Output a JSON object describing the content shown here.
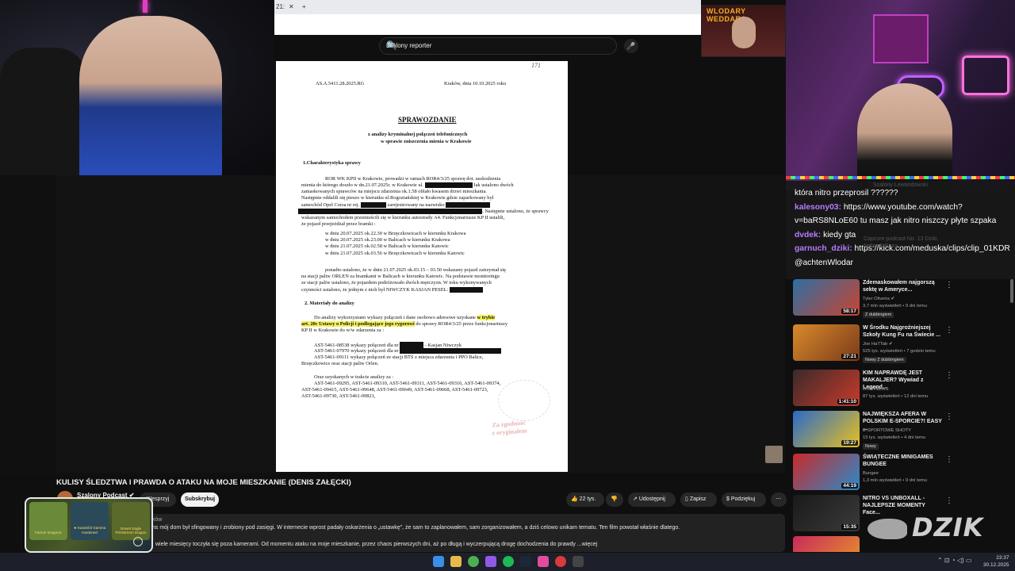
{
  "browser": {
    "tab_fragment": "21:",
    "close_tab": "✕",
    "new_tab": "+",
    "search_query": "szalony reporter",
    "keyboard_icon": "⌨",
    "clear": "✕",
    "search_icon": "🔍",
    "mic_icon": "🎤"
  },
  "overlay": {
    "logo_text": "WLODARY WEDDARA"
  },
  "document": {
    "page_mark": "171",
    "ref": "AS.A.5411.28.2025.RG",
    "place_date": "Kraków, dnia   10.10.2025 roku",
    "heading": "SPRAWOZDANIE",
    "sub1": "z analizy kryminalnej połączeń telefonicznych",
    "sub2": "w sprawie zniszczenia mienia w Krakowie",
    "sec1": "1.Charakterystyka sprawy",
    "p1_l1": "ROR WK KPII w Krakowie, prowadzi w ramach ROR4/3/25 sprawę dot. uszkodzenia",
    "p1_l2": "mienia do którego doszło w dn.21.07.2025r. w Krakowie ul.",
    "p1_l2b": "Jak ustalono dwóch",
    "p1_l3": "zamaskowanych sprawców na miejscu zdarzenia ok.1.58 oblało kwasem drzwi mieszkania.",
    "p1_l4": "Następnie oddalili się pieszo w kierunku ul.Rogoziańskiej w Krakowie gdzie zaparkowany był",
    "p1_l5": "samochód   Opel   Corsa   nr   rej.",
    "p1_l5b": "zarejestrowany   na   nazwisko",
    "p1_l6b": ". Następnie ustalono, że sprawcy",
    "p1_l7": "wskazanym samochodem przemieścili się w kierunku autostrady A4. Funkcjonariusze KP II ustalili,",
    "p1_l8": "że pojazd przejeżdżał przez bramki :",
    "gates": [
      "w dniu 20.07.2025 ok.22.30 w Brzęczkowicach w kierunku Krakowa",
      "w dniu 20.07.2025 ok.23.00 w Balicach w kierunku Krakowa",
      "w dniu 21.07.2025 ok.02.58 w Balicach w kierunku Katowic",
      "w dniu 21.07.2025 ok.03.56 w Brzęczkowicach w kierunku Katowic"
    ],
    "p2_l1": "ponadto ustalono, że w dniu 21.07.2025 ok.03.15 – 03.50 wskazany pojazd zatrzymał się",
    "p2_l2": "na stacji paliw ORLEN  za bramkami w Balicach w kierunku Katowic.  Na podstawie monitoringu",
    "p2_l3": "ze stacji paliw ustalono, że pojazdem podróżowało dwóch mężczyzn.  W toku wykonywanych",
    "p2_l4": "czynności ustalono, że jednym z nich był NIWCZYK KASJAN PESEL:",
    "sec2": "2. Materiały do analizy",
    "p3_l1a": "Do analizy wykorzystano wykazy połączeń i dane osobowo adresowe uzyskane",
    "p3_l1b": "w trybie",
    "p3_l2a": "art. 20c Ustawy o Policji i podlegające jego rygorowi",
    "p3_l2b": "do sprawy ROR4/3/25  przez funkcjonariuszy",
    "p3_l3": "KP II w Krakowie do w/w zdarzenia za :",
    "ast1a": "AST-5461-08538 wykazy połączeń dla nr",
    "ast1b": "- Kasjan Niwczyk",
    "ast2": "AST-5461-07970 wykazy połączeń dla nr",
    "ast3": "AST-5461-09111  wykazy  połączeń  ze  stacji  BTS  z  miejsca  zdarzenia  i  PPO  Balice,",
    "ast3b": "Brzęczkowice oraz stacji paliw Orlen.",
    "p4_l1": "Oraz uzyskanych w trakcie analizy za :",
    "p4_l2": "AST-5461-09295,   AST-5461-09310,   AST-5461-09311,   AST-5461-09316,   AST-5461-09374,",
    "p4_l3": "AST-5461-09415,    AST-5461-09648,    AST-5461-09649,    AST-5461-09668,    AST-5461-09723,",
    "p4_l4": "AST-5461-09730, AST-5461-09821,",
    "stamp_l1": "Za zgodność",
    "stamp_l2": "z oryginałem"
  },
  "chat": {
    "ghost_top": "Szalony Lewandowski",
    "rows": [
      {
        "user": "",
        "msg": "która nitro przeprosil ??????"
      },
      {
        "user": "kalesony03:",
        "msg": " https://www.youtube.com/watch?"
      },
      {
        "user": "",
        "msg": "v=baRS8NLoE60 tu masz jak nitro niszczy płyte szpaka"
      },
      {
        "user": "dvdek:",
        "msg": " kiedy gta"
      },
      {
        "user": "garnuch_dziki:",
        "msg": " https://kick.com/meduska/clips/clip_01KDR"
      },
      {
        "user": "",
        "msg": "@achtenWlodar"
      }
    ],
    "ghost_a": "Capcure podcast No. 13 Dziki,",
    "ghost_b": "Nefas & Enzo"
  },
  "recommendations": [
    {
      "title": "Zdemaskowałem najgorszą sektę w Ameryce...",
      "channel": "Tyler Oliveira ✔",
      "meta": "3,7 mln wyświetleń • 9 dni temu",
      "badge": "Z dubbingiem",
      "duration": "58:17",
      "c1": "#2e6ea3",
      "c2": "#c9442f"
    },
    {
      "title": "W Środku Najgroźniejszej Szkoły Kung Fu na Świecie ...",
      "channel": "Joe HaTTab ✔",
      "meta": "525 tys. wyświetleń • 7 godzin temu",
      "badge": "Nowy   Z dubbingiem",
      "duration": "27:21",
      "c1": "#d98a2b",
      "c2": "#7a3a1a"
    },
    {
      "title": "KIM NAPRAWDĘ JEST MAKALJER? Wywiad z Legend...",
      "channel": "DOMINEWS",
      "meta": "87 tys. wyświetleń • 12 dni temu",
      "badge": "",
      "duration": "1:41:10",
      "c1": "#3a2a2a",
      "c2": "#c93a2a"
    },
    {
      "title": "NAJWIĘKSZA AFERA W POLSKIM E-SPORCIE?! EASY ...",
      "channel": "E-SPORTOWE SHOTY",
      "meta": "15 tys. wyświetleń • 4 dni temu",
      "badge": "Nowy",
      "duration": "19:27",
      "c1": "#2a6ac9",
      "c2": "#e8c020"
    },
    {
      "title": "ŚWIĄTECZNE MINIGAMES BUNGEE",
      "channel": "Bungee",
      "meta": "1,3 mln wyświetleń • 9 dni temu",
      "badge": "",
      "duration": "44:19",
      "c1": "#c92a2a",
      "c2": "#2a8ac9"
    },
    {
      "title": "NITRO VS UNBOXALL - NAJLEPSZE MOMENTY Face...",
      "channel": "",
      "meta": "",
      "badge": "",
      "duration": "15:35",
      "c1": "#1a1a1a",
      "c2": "#3a3a3a"
    },
    {
      "title": "",
      "channel": "",
      "meta": "",
      "badge": "",
      "duration": "",
      "c1": "#c92a5a",
      "c2": "#e89a2a"
    }
  ],
  "watermark": "DZIK",
  "video": {
    "title": "KULISY ŚLEDZTWA I PRAWDA O ATAKU NA MOJE MIESZKANIE (DENIS ZAŁĘCKI)",
    "channel": "Szalony Podcast ✔",
    "support": "Wesprzyj",
    "subscribe": "Subskrybuj",
    "likes": "22 tys.",
    "share": "Udostępnij",
    "save": "Zapisz",
    "thanks": "Podziękuj",
    "more": "⋯",
    "views_fragment": "ków",
    "desc_l1": "ns mój dom był sfingowany i zrobiony pod zasięgi. W internecie wprost padały oskarżenia o „ustawkę”, że sam to zaplanowałem, sam zorganizowałem, a dziś celowo unikam tematu. Ten film powstał właśnie dlatego.",
    "desc_l2": "wiele miesięcy toczyła się poza kamerami. Od momentu ataku na moje mieszkanie, przez chaos pierwszych dni, aż po długą i wyczerpującą drogę dochodzenia do prawdy  ...więcej"
  },
  "card": {
    "items": [
      {
        "label": "Farmer Dragonic",
        "c": "#6a8a3a"
      },
      {
        "label": "★ Karambit Gamma Hardened",
        "c": "#2a4a5a"
      },
      {
        "label": "Desert Eagle Printstream Dragon",
        "c": "#5a6a2a"
      }
    ]
  },
  "taskbar": {
    "time": "23:37",
    "date": "30.12.2025",
    "tray": "⌃  ⊡  ◔  ◁)  ▭"
  }
}
